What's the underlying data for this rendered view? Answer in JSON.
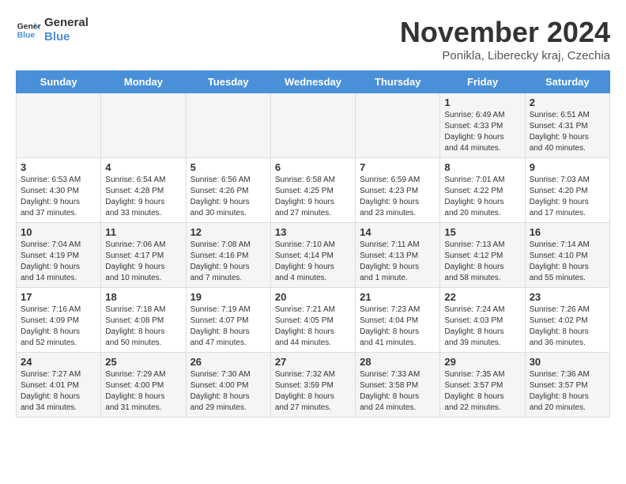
{
  "logo": {
    "line1": "General",
    "line2": "Blue"
  },
  "title": "November 2024",
  "subtitle": "Ponikla, Liberecky kraj, Czechia",
  "headers": [
    "Sunday",
    "Monday",
    "Tuesday",
    "Wednesday",
    "Thursday",
    "Friday",
    "Saturday"
  ],
  "weeks": [
    [
      {
        "day": "",
        "info": ""
      },
      {
        "day": "",
        "info": ""
      },
      {
        "day": "",
        "info": ""
      },
      {
        "day": "",
        "info": ""
      },
      {
        "day": "",
        "info": ""
      },
      {
        "day": "1",
        "info": "Sunrise: 6:49 AM\nSunset: 4:33 PM\nDaylight: 9 hours\nand 44 minutes."
      },
      {
        "day": "2",
        "info": "Sunrise: 6:51 AM\nSunset: 4:31 PM\nDaylight: 9 hours\nand 40 minutes."
      }
    ],
    [
      {
        "day": "3",
        "info": "Sunrise: 6:53 AM\nSunset: 4:30 PM\nDaylight: 9 hours\nand 37 minutes."
      },
      {
        "day": "4",
        "info": "Sunrise: 6:54 AM\nSunset: 4:28 PM\nDaylight: 9 hours\nand 33 minutes."
      },
      {
        "day": "5",
        "info": "Sunrise: 6:56 AM\nSunset: 4:26 PM\nDaylight: 9 hours\nand 30 minutes."
      },
      {
        "day": "6",
        "info": "Sunrise: 6:58 AM\nSunset: 4:25 PM\nDaylight: 9 hours\nand 27 minutes."
      },
      {
        "day": "7",
        "info": "Sunrise: 6:59 AM\nSunset: 4:23 PM\nDaylight: 9 hours\nand 23 minutes."
      },
      {
        "day": "8",
        "info": "Sunrise: 7:01 AM\nSunset: 4:22 PM\nDaylight: 9 hours\nand 20 minutes."
      },
      {
        "day": "9",
        "info": "Sunrise: 7:03 AM\nSunset: 4:20 PM\nDaylight: 9 hours\nand 17 minutes."
      }
    ],
    [
      {
        "day": "10",
        "info": "Sunrise: 7:04 AM\nSunset: 4:19 PM\nDaylight: 9 hours\nand 14 minutes."
      },
      {
        "day": "11",
        "info": "Sunrise: 7:06 AM\nSunset: 4:17 PM\nDaylight: 9 hours\nand 10 minutes."
      },
      {
        "day": "12",
        "info": "Sunrise: 7:08 AM\nSunset: 4:16 PM\nDaylight: 9 hours\nand 7 minutes."
      },
      {
        "day": "13",
        "info": "Sunrise: 7:10 AM\nSunset: 4:14 PM\nDaylight: 9 hours\nand 4 minutes."
      },
      {
        "day": "14",
        "info": "Sunrise: 7:11 AM\nSunset: 4:13 PM\nDaylight: 9 hours\nand 1 minute."
      },
      {
        "day": "15",
        "info": "Sunrise: 7:13 AM\nSunset: 4:12 PM\nDaylight: 8 hours\nand 58 minutes."
      },
      {
        "day": "16",
        "info": "Sunrise: 7:14 AM\nSunset: 4:10 PM\nDaylight: 8 hours\nand 55 minutes."
      }
    ],
    [
      {
        "day": "17",
        "info": "Sunrise: 7:16 AM\nSunset: 4:09 PM\nDaylight: 8 hours\nand 52 minutes."
      },
      {
        "day": "18",
        "info": "Sunrise: 7:18 AM\nSunset: 4:08 PM\nDaylight: 8 hours\nand 50 minutes."
      },
      {
        "day": "19",
        "info": "Sunrise: 7:19 AM\nSunset: 4:07 PM\nDaylight: 8 hours\nand 47 minutes."
      },
      {
        "day": "20",
        "info": "Sunrise: 7:21 AM\nSunset: 4:05 PM\nDaylight: 8 hours\nand 44 minutes."
      },
      {
        "day": "21",
        "info": "Sunrise: 7:23 AM\nSunset: 4:04 PM\nDaylight: 8 hours\nand 41 minutes."
      },
      {
        "day": "22",
        "info": "Sunrise: 7:24 AM\nSunset: 4:03 PM\nDaylight: 8 hours\nand 39 minutes."
      },
      {
        "day": "23",
        "info": "Sunrise: 7:26 AM\nSunset: 4:02 PM\nDaylight: 8 hours\nand 36 minutes."
      }
    ],
    [
      {
        "day": "24",
        "info": "Sunrise: 7:27 AM\nSunset: 4:01 PM\nDaylight: 8 hours\nand 34 minutes."
      },
      {
        "day": "25",
        "info": "Sunrise: 7:29 AM\nSunset: 4:00 PM\nDaylight: 8 hours\nand 31 minutes."
      },
      {
        "day": "26",
        "info": "Sunrise: 7:30 AM\nSunset: 4:00 PM\nDaylight: 8 hours\nand 29 minutes."
      },
      {
        "day": "27",
        "info": "Sunrise: 7:32 AM\nSunset: 3:59 PM\nDaylight: 8 hours\nand 27 minutes."
      },
      {
        "day": "28",
        "info": "Sunrise: 7:33 AM\nSunset: 3:58 PM\nDaylight: 8 hours\nand 24 minutes."
      },
      {
        "day": "29",
        "info": "Sunrise: 7:35 AM\nSunset: 3:57 PM\nDaylight: 8 hours\nand 22 minutes."
      },
      {
        "day": "30",
        "info": "Sunrise: 7:36 AM\nSunset: 3:57 PM\nDaylight: 8 hours\nand 20 minutes."
      }
    ]
  ]
}
